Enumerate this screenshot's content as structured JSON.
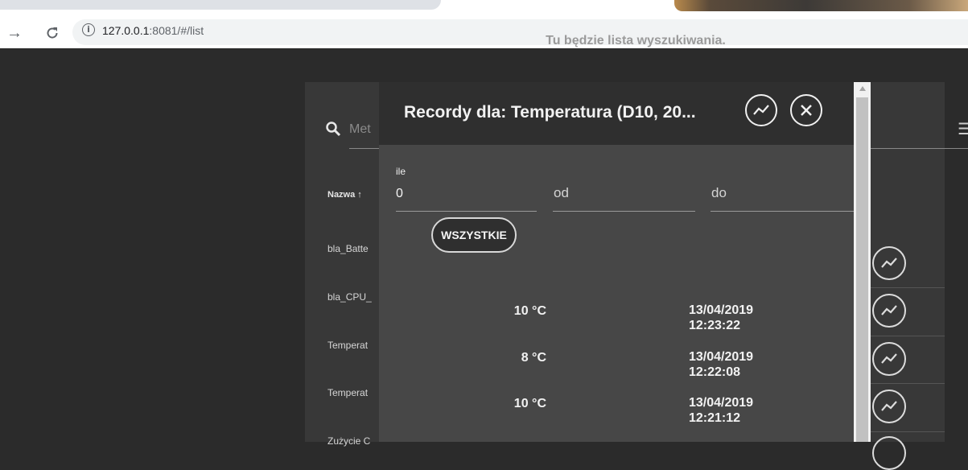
{
  "browser": {
    "url_host": "127.0.0.1",
    "url_rest": ":8081/#/list"
  },
  "page": {
    "heading": "Tu będzie lista wyszukiwania."
  },
  "list": {
    "search_placeholder": "Met",
    "column_header": "Nazwa ↑",
    "rows": [
      "bla_Batte",
      "bla_CPU_",
      "Temperat",
      "Temperat",
      "Zużycie C"
    ]
  },
  "dialog": {
    "title": "Recordy dla: Temperatura (D10, 20...",
    "fields": {
      "ile_label": "ile",
      "ile_value": "0",
      "od_placeholder": "od",
      "do_placeholder": "do"
    },
    "all_button_label": "WSZYSTKIE",
    "records": [
      {
        "value": "10 °C",
        "date": "13/04/2019",
        "time": "12:23:22"
      },
      {
        "value": "8 °C",
        "date": "13/04/2019",
        "time": "12:22:08"
      },
      {
        "value": "10 °C",
        "date": "13/04/2019",
        "time": "12:21:12"
      }
    ]
  }
}
